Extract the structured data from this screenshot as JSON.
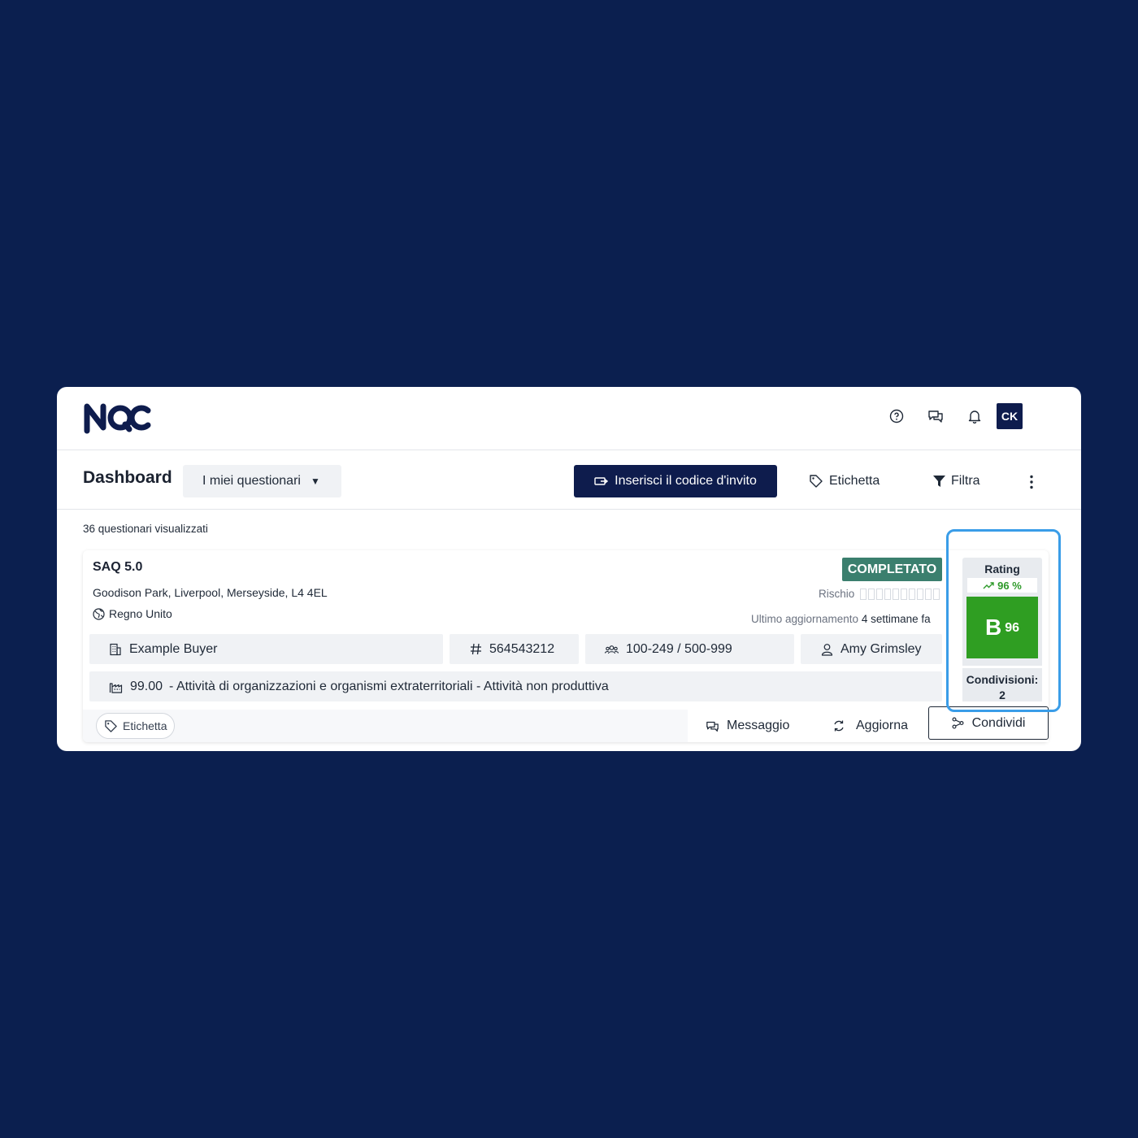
{
  "logo": {
    "text": "NQC"
  },
  "topbar": {
    "icons": [
      "help-icon",
      "chat-icon",
      "bell-icon"
    ],
    "avatar_initials": "CK"
  },
  "header": {
    "title": "Dashboard",
    "dropdown_label": "I miei questionari",
    "invite_button": "Inserisci il codice d'invito",
    "label_button": "Etichetta",
    "filter_button": "Filtra"
  },
  "content": {
    "count_text": "36 questionari visualizzati"
  },
  "card": {
    "title": "SAQ 5.0",
    "address": "Goodison Park, Liverpool, Merseyside, L4 4EL",
    "country": "Regno Unito",
    "status": "COMPLETATO",
    "risk_label": "Rischio",
    "risk_level": 0,
    "updated_label": "Ultimo aggiornamento",
    "updated_value": "4 settimane fa",
    "buyer": "Example Buyer",
    "id_number": "564543212",
    "employees": "100-249 / 500-999",
    "contact": "Amy Grimsley",
    "industry_code": "99.00",
    "industry_desc": "- Attività di organizzazioni e organismi extraterritoriali - Attività non produttiva",
    "tag_label": "Etichetta",
    "actions": {
      "message": "Messaggio",
      "refresh": "Aggiorna",
      "share": "Condividi"
    }
  },
  "rating": {
    "label": "Rating",
    "trend": "96 %",
    "grade": "B",
    "score": "96",
    "shares_label": "Condivisioni:",
    "shares_count": "2"
  },
  "colors": {
    "background": "#0b1f4f",
    "primary": "#0e1c4d",
    "status_completed": "#3b7f6e",
    "grade_green": "#2f9e22",
    "highlight": "#3a9de8"
  }
}
